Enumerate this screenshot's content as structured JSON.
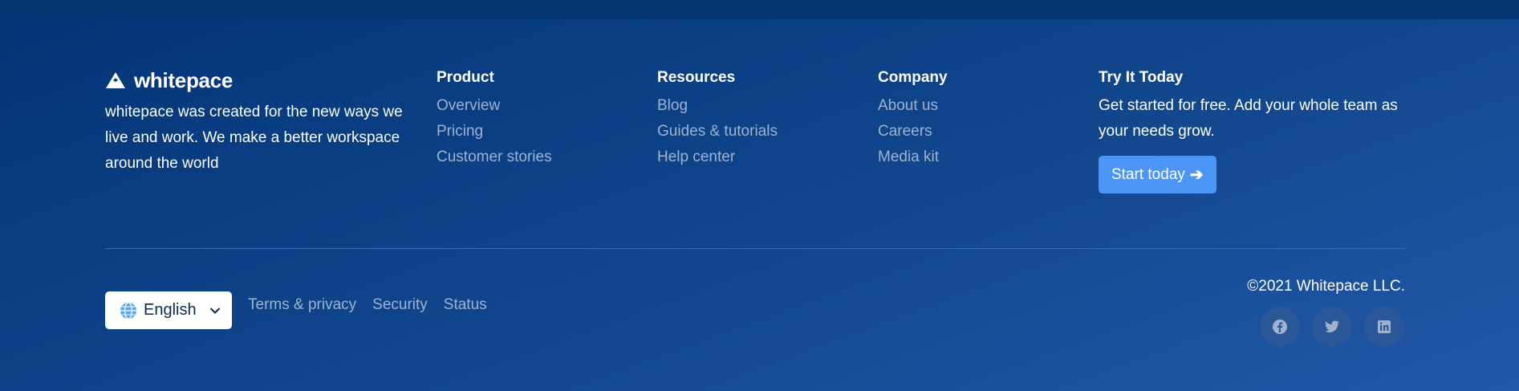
{
  "brand": {
    "name": "whitepace",
    "description": "whitepace was created for the new ways we live and work. We make a better workspace around the world"
  },
  "columns": {
    "product": {
      "title": "Product",
      "links": [
        "Overview",
        "Pricing",
        "Customer stories"
      ]
    },
    "resources": {
      "title": "Resources",
      "links": [
        "Blog",
        "Guides & tutorials",
        "Help center"
      ]
    },
    "company": {
      "title": "Company",
      "links": [
        "About us",
        "Careers",
        "Media kit"
      ]
    }
  },
  "try_today": {
    "title": "Try It Today",
    "description": "Get started for free. Add your whole team as your needs grow.",
    "cta_label": "Start today",
    "cta_icon": "arrow-right-icon"
  },
  "language": {
    "selected": "English",
    "icon": "globe-icon",
    "chevron": "chevron-down-icon"
  },
  "legal_links": [
    "Terms & privacy",
    "Security",
    "Status"
  ],
  "copyright": "©2021 Whitepace LLC.",
  "socials": [
    "facebook-icon",
    "twitter-icon",
    "linkedin-icon"
  ],
  "colors": {
    "background_start": "#033375",
    "background_end": "#2158a9",
    "accent": "#4c96f7",
    "muted_link": "#9fb3cf",
    "social_bg": "#2b5798"
  }
}
